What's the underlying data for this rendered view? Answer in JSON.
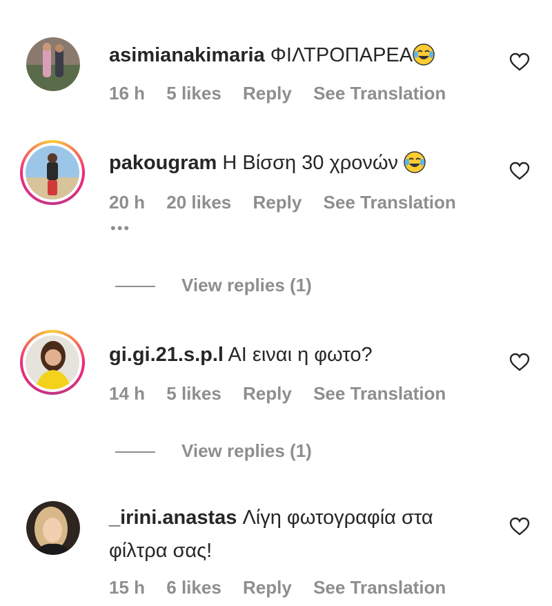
{
  "comments": [
    {
      "username": "asimianakimaria",
      "text": "ΦΙΛΤΡΟΠΑΡΕΑ",
      "emoji": "tears-of-joy",
      "time": "16 h",
      "likes": "5 likes",
      "reply": "Reply",
      "translate": "See Translation",
      "story_ring": false
    },
    {
      "username": "pakougram",
      "text": "Η Βίσση 30 χρονών",
      "emoji": "tears-of-joy",
      "time": "20 h",
      "likes": "20 likes",
      "reply": "Reply",
      "translate": "See Translation",
      "more": "•••",
      "view_replies": "View replies (1)",
      "story_ring": true
    },
    {
      "username": "gi.gi.21.s.p.l",
      "text": "AI ειναι η φωτο?",
      "time": "14 h",
      "likes": "5 likes",
      "reply": "Reply",
      "translate": "See Translation",
      "view_replies": "View replies (1)",
      "story_ring": true
    },
    {
      "username": "_irini.anastas",
      "text": "Λίγη φωτογραφία στα",
      "text_line2": "φίλτρα σας!",
      "time": "15 h",
      "likes": "6 likes",
      "reply": "Reply",
      "translate": "See Translation",
      "story_ring": false
    }
  ],
  "colors": {
    "text": "#262626",
    "secondary": "#8e8e8e",
    "ring_start": "#f9ce34",
    "ring_mid": "#ee2a7b"
  },
  "icons": {
    "like": "heart-outline-icon",
    "emoji": "face-with-tears-of-joy"
  }
}
